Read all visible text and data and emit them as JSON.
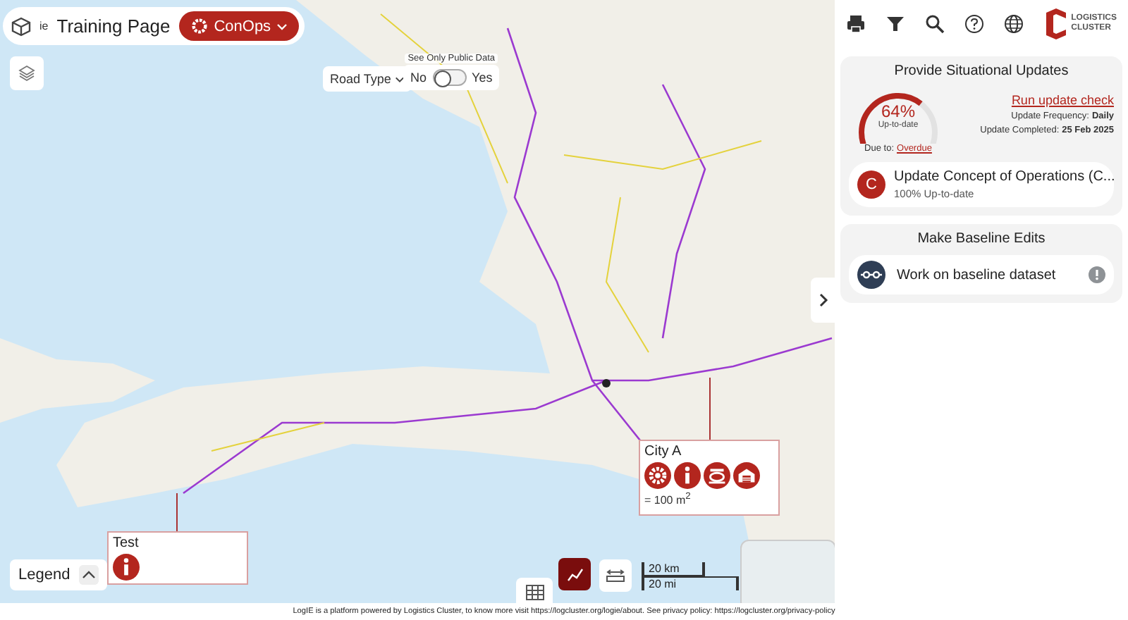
{
  "header": {
    "logo_text": "ie",
    "title": "Training Page",
    "menu": "ConOps"
  },
  "filters": {
    "road_type": "Road Type",
    "public_toggle": {
      "label": "See Only Public Data",
      "off_label": "No",
      "on_label": "Yes",
      "on": false
    }
  },
  "map_popups": [
    {
      "title": "City A",
      "icons": [
        {
          "kind": "gear"
        },
        {
          "kind": "info"
        },
        {
          "kind": "vehicle"
        },
        {
          "kind": "warehouse"
        }
      ],
      "note": "= 100 m$^{2}$"
    },
    {
      "title": "Test",
      "icons": [
        {
          "kind": "info"
        }
      ]
    }
  ],
  "legend": {
    "label": "Legend",
    "expanded": false
  },
  "scale": {
    "metric": "20 km",
    "imperial": "20 mi"
  },
  "logo": {
    "line_1": "LOGISTICS",
    "line_2": "CLUSTER"
  },
  "situational": {
    "title": "Provide Situational Updates",
    "gauge": {
      "level": 0.64,
      "percent": "64%",
      "caption": "Up-to-date"
    },
    "due_label": "Due to:",
    "due_link": "Overdue",
    "run_link": "Run update check",
    "frequency_label": "Update Frequency:",
    "frequency": "Daily",
    "completed_label": "Update Completed:",
    "completed": "25 Feb 2025",
    "task": {
      "badge": "C",
      "title": "Update Concept of Operations (C...",
      "subtitle": "100% Up-to-date"
    }
  },
  "baseline": {
    "title": "Make Baseline Edits",
    "item": "Work on baseline dataset"
  },
  "footer": "LogIE is a platform powered by Logistics Cluster, to know more visit https://logcluster.org/logie/about. See privacy policy: https://logcluster.org/privacy-policy"
}
